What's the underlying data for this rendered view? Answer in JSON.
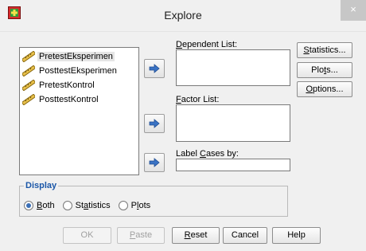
{
  "window": {
    "title": "Explore",
    "close_glyph": "×"
  },
  "variables": {
    "items": [
      {
        "label": "PretestEksperimen",
        "selected": true
      },
      {
        "label": "PosttestEksperimen",
        "selected": false
      },
      {
        "label": "PretestKontrol",
        "selected": false
      },
      {
        "label": "PosttestKontrol",
        "selected": false
      }
    ]
  },
  "fields": {
    "dependent": {
      "label_mnemonic": "D",
      "label_rest": "ependent List:"
    },
    "factor": {
      "label_mnemonic": "F",
      "label_rest": "actor List:"
    },
    "label_cases": {
      "label_pre": "Label ",
      "label_mnemonic": "C",
      "label_rest": "ases by:"
    }
  },
  "side_buttons": {
    "statistics": {
      "mnemonic": "S",
      "rest": "tatistics..."
    },
    "plots": {
      "pre": "Plo",
      "mnemonic": "t",
      "rest": "s..."
    },
    "options": {
      "mnemonic": "O",
      "rest": "ptions..."
    }
  },
  "display": {
    "title": "Display",
    "options": [
      {
        "mnemonic": "B",
        "rest": "oth",
        "checked": true
      },
      {
        "pre": "St",
        "mnemonic": "a",
        "rest": "tistics",
        "checked": false
      },
      {
        "pre": "P",
        "mnemonic": "l",
        "rest": "ots",
        "checked": false
      }
    ]
  },
  "bottom_buttons": {
    "ok": {
      "label": "OK",
      "enabled": false
    },
    "paste": {
      "mnemonic": "P",
      "rest": "aste",
      "enabled": false
    },
    "reset": {
      "mnemonic": "R",
      "rest": "eset",
      "enabled": true
    },
    "cancel": {
      "label": "Cancel",
      "enabled": true
    },
    "help": {
      "label": "Help",
      "enabled": true
    }
  },
  "colors": {
    "accent": "#1a56a8",
    "arrow": "#3a73c4"
  },
  "icons": {
    "app": "spss-explore-icon",
    "variable": "scale-ruler-icon",
    "move": "right-arrow-icon"
  }
}
